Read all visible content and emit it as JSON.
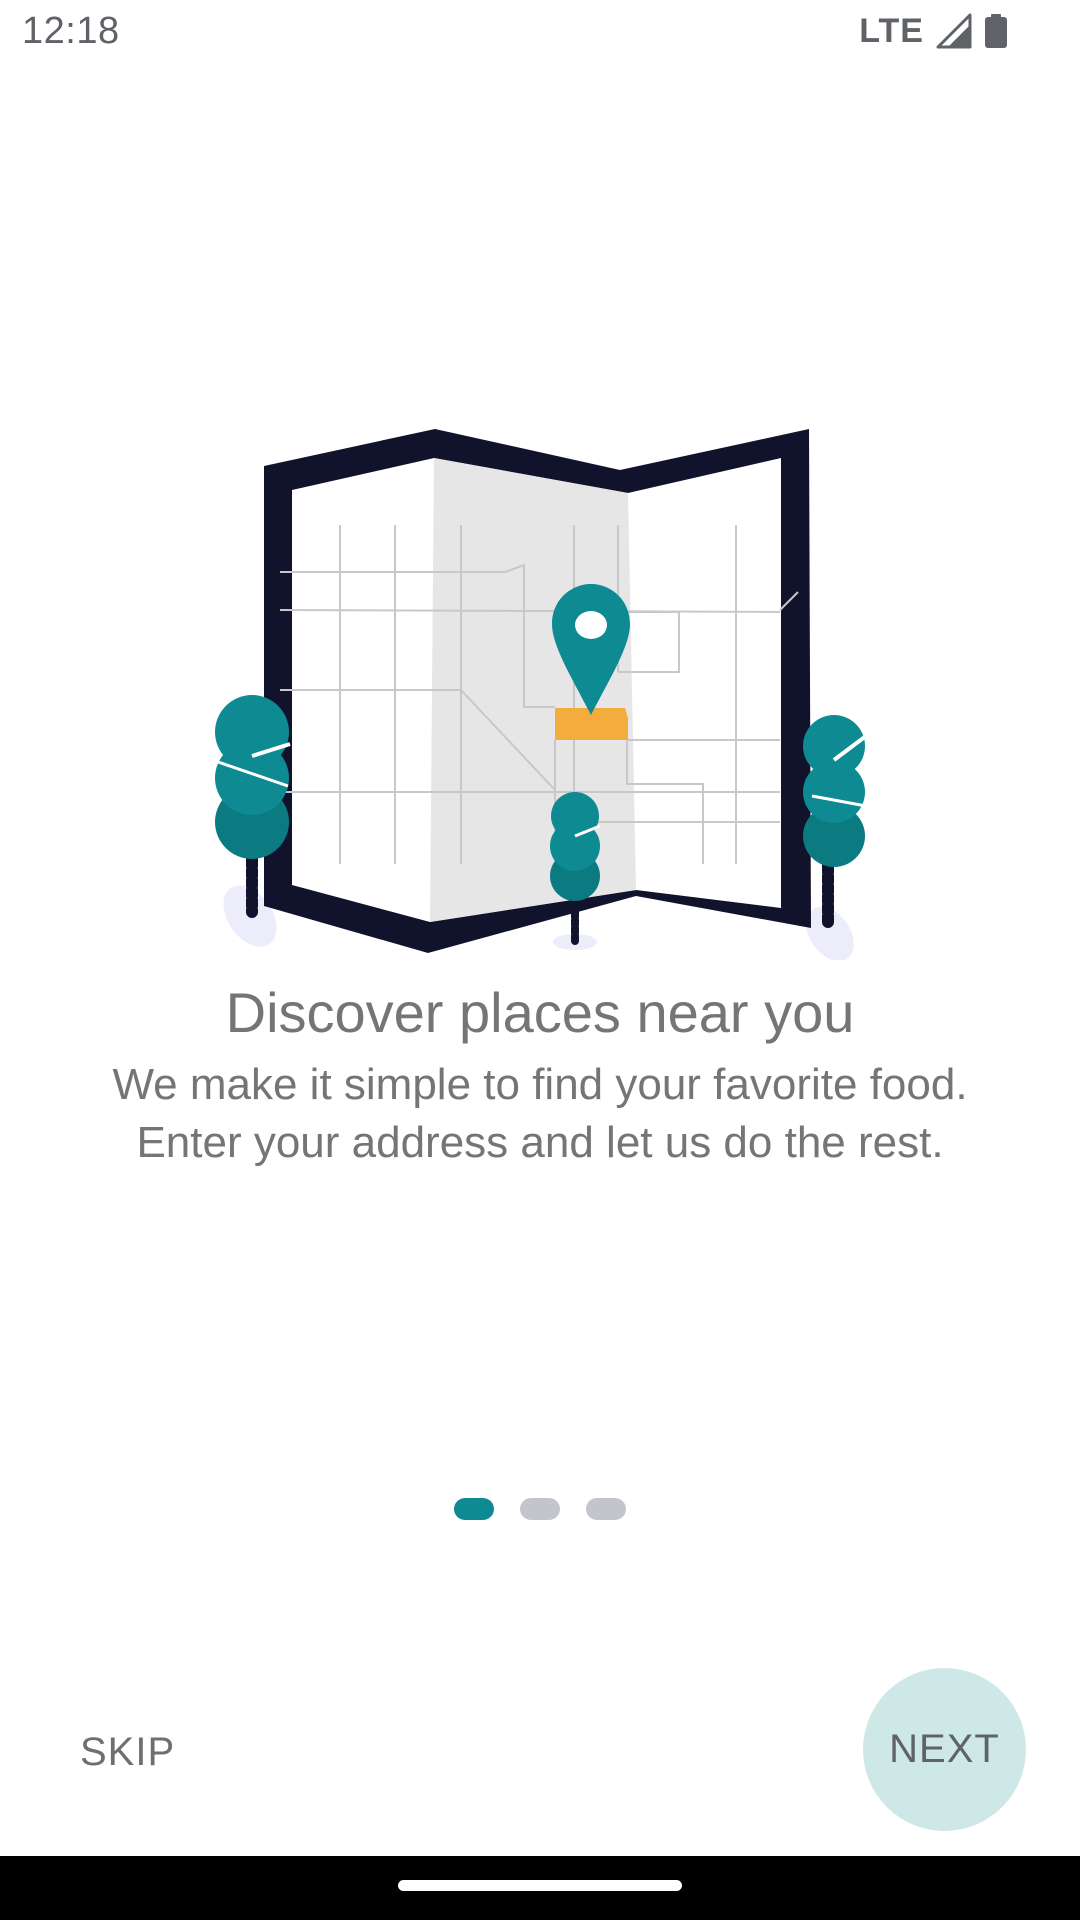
{
  "status_bar": {
    "time": "12:18",
    "network": "LTE",
    "icons": [
      "signal-icon",
      "battery-icon"
    ]
  },
  "illustration": {
    "icon": "map-location-icon",
    "colors": {
      "frame": "#11132c",
      "paper": "#ffffff",
      "fold": "#e6e6e6",
      "roads": "#c8c8c8",
      "pin": "#0e8a93",
      "block": "#f4ad3d",
      "tree": "#0e8a93",
      "tree_dark": "#0b7b81",
      "trunk": "#11132c",
      "shadow": "#ececfb"
    }
  },
  "onboarding": {
    "title": "Discover places near you",
    "description_lines": [
      "We make it simple to find your favorite food.",
      "Enter your address and let us do the rest."
    ]
  },
  "pager": {
    "total_pages": 3,
    "current_page": 1,
    "active_color": "#0e8a93",
    "inactive_color": "#c4c4cc"
  },
  "actions": {
    "skip_label": "SKIP",
    "next_label": "NEXT"
  },
  "colors": {
    "accent": "#0e8a93",
    "next_bg": "#cde8e6",
    "text": "#757575"
  }
}
